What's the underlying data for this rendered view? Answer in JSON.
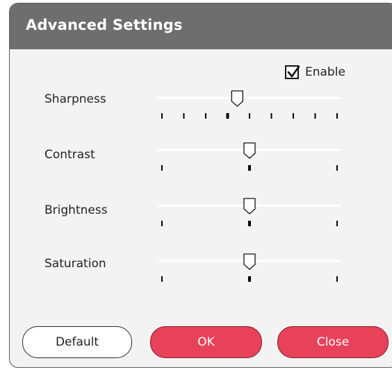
{
  "dialog": {
    "title": "Advanced Settings",
    "enable": {
      "label": "Enable",
      "checked": true
    },
    "sliders": [
      {
        "label": "Sharpness",
        "position": 0.43,
        "ticks": 9
      },
      {
        "label": "Contrast",
        "position": 0.5,
        "ticks": 3
      },
      {
        "label": "Brightness",
        "position": 0.5,
        "ticks": 3
      },
      {
        "label": "Saturation",
        "position": 0.5,
        "ticks": 3
      }
    ],
    "buttons": {
      "default_label": "Default",
      "ok_label": "OK",
      "close_label": "Close"
    }
  },
  "colors": {
    "titlebar": "#6e6e6e",
    "panel": "#f3f3f3",
    "accent": "#e8415a"
  }
}
